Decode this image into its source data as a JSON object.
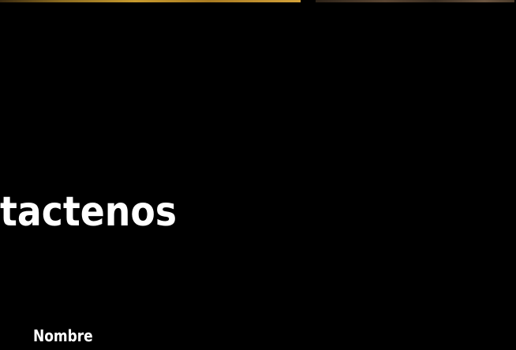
{
  "contact": {
    "heading": "tactenos",
    "name_label": "Nombre"
  },
  "colors": {
    "background": "#000000",
    "text": "#ffffff",
    "accent_gold": "#c79a2e"
  }
}
